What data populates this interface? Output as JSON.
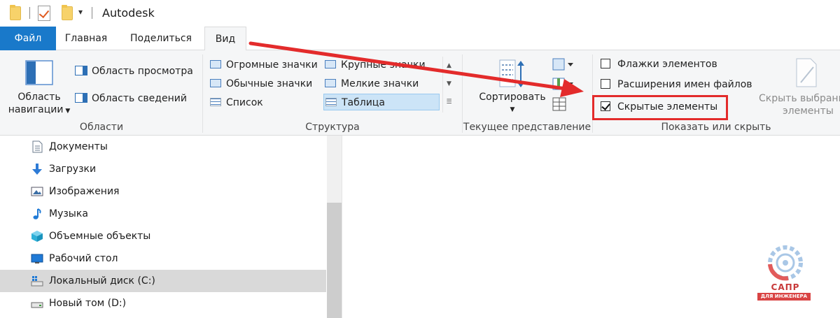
{
  "titlebar": {
    "title": "Autodesk",
    "dropdown_glyph": "▾"
  },
  "tabs": [
    {
      "label": "Файл"
    },
    {
      "label": "Главная"
    },
    {
      "label": "Поделиться"
    },
    {
      "label": "Вид"
    }
  ],
  "ribbon": {
    "areas": {
      "group_label": "Области",
      "nav_pane_line1": "Область",
      "nav_pane_line2": "навигации",
      "preview_pane": "Область просмотра",
      "details_pane": "Область сведений"
    },
    "structure": {
      "group_label": "Структура",
      "items": [
        "Огромные значки",
        "Крупные значки",
        "Обычные значки",
        "Мелкие значки",
        "Список",
        "Таблица"
      ],
      "selected": "Таблица"
    },
    "current_view": {
      "group_label": "Текущее представление",
      "sort_label": "Сортировать"
    },
    "show_hide": {
      "group_label": "Показать или скрыть",
      "item_checkboxes": "Флажки элементов",
      "file_extensions": "Расширения имен файлов",
      "hidden_items": "Скрытые элементы",
      "hidden_items_checked": true,
      "hide_selected_line1": "Скрыть выбранн",
      "hide_selected_line2": "элементы"
    }
  },
  "navigation": {
    "items": [
      {
        "label": "Документы",
        "icon": "documents-icon"
      },
      {
        "label": "Загрузки",
        "icon": "downloads-icon"
      },
      {
        "label": "Изображения",
        "icon": "pictures-icon"
      },
      {
        "label": "Музыка",
        "icon": "music-icon"
      },
      {
        "label": "Объемные объекты",
        "icon": "3d-objects-icon"
      },
      {
        "label": "Рабочий стол",
        "icon": "desktop-icon"
      },
      {
        "label": "Локальный диск (C:)",
        "icon": "local-disk-icon",
        "selected": true
      },
      {
        "label": "Новый том (D:)",
        "icon": "drive-icon"
      }
    ]
  },
  "watermark": {
    "title": "САПР",
    "subtitle": "ДЛЯ ИНЖЕНЕРА"
  },
  "colors": {
    "file_tab": "#1979ca",
    "annotation_red": "#e32b2b",
    "ribbon_bg": "#f5f6f7",
    "selection": "#cce4f7"
  }
}
